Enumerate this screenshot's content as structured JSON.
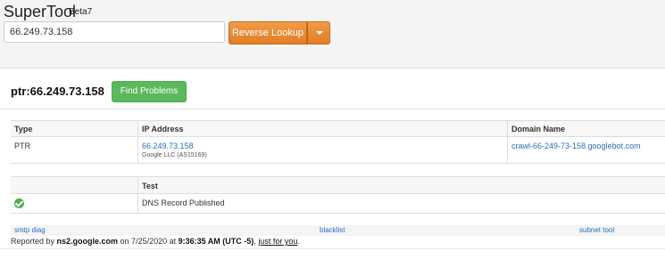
{
  "app": {
    "title": "SuperTool",
    "version": "Beta7"
  },
  "search": {
    "value": "66.249.73.158"
  },
  "actions": {
    "primary_label": "Reverse Lookup",
    "secondary": "Find Problems"
  },
  "result": {
    "label": "ptr:66.249.73.158"
  },
  "records": {
    "headers": [
      "Type",
      "IP Address",
      "Domain Name"
    ],
    "row": {
      "type": "PTR",
      "ip": "66.249.73.158",
      "asn": "Google LLC (AS15169)",
      "domain": "crawl-66-249-73-158.googlebot.com"
    }
  },
  "tests": {
    "header": "Test",
    "items": [
      {
        "status": "pass",
        "name": "DNS Record Published"
      }
    ]
  },
  "footer": {
    "links": [
      "smtp diag",
      "blacklist",
      "subnet tool"
    ],
    "reported_prefix": "Reported by ",
    "server": "ns2.google.com",
    "on_text": " on 7/25/2020 at ",
    "time": "9:36:35 AM (UTC -5)",
    "comma": ", ",
    "just_for_you": "just for you",
    "period": "."
  },
  "colors": {
    "accent_orange": "#e8862e",
    "success_green": "#5cb85c",
    "link_blue": "#2a6ebb"
  }
}
